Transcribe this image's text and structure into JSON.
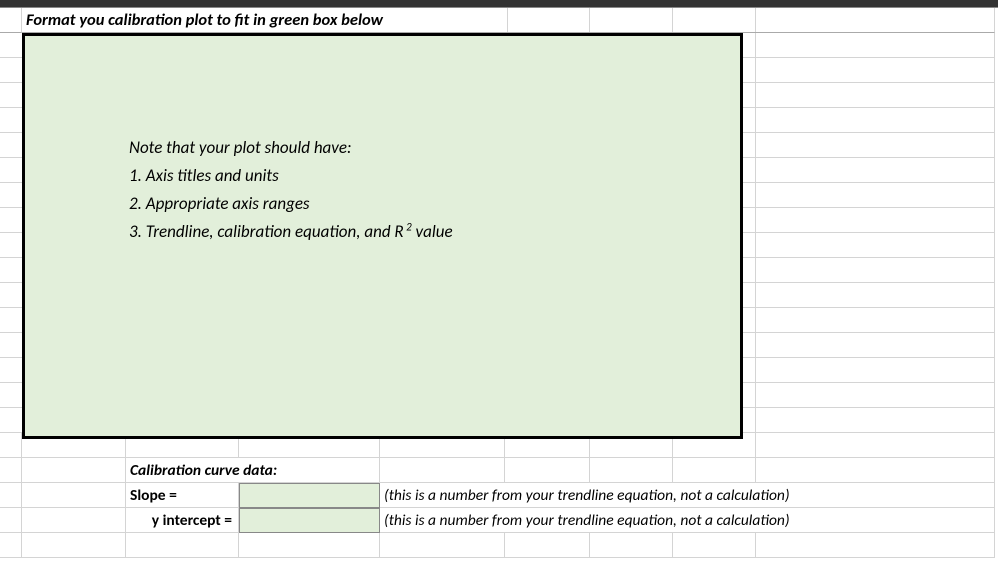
{
  "header": "Format you calibration plot to fit in green box below",
  "note": {
    "title": "Note that your plot should have:",
    "item1": "1.  Axis titles and units",
    "item2": "2.  Appropriate axis ranges",
    "item3_prefix": "3.  Trendline, calibration equation, and R",
    "item3_sup": " 2",
    "item3_suffix": "  value"
  },
  "calib": {
    "heading": "Calibration curve data:",
    "slope_label": "Slope =",
    "slope_value": "",
    "slope_desc": "(this is a number from your trendline equation, not a calculation)",
    "yint_label": "y intercept =",
    "yint_value": "",
    "yint_desc": "(this is a number from your trendline equation, not a calculation)"
  },
  "right_col_widths": [
    82,
    83,
    83
  ]
}
